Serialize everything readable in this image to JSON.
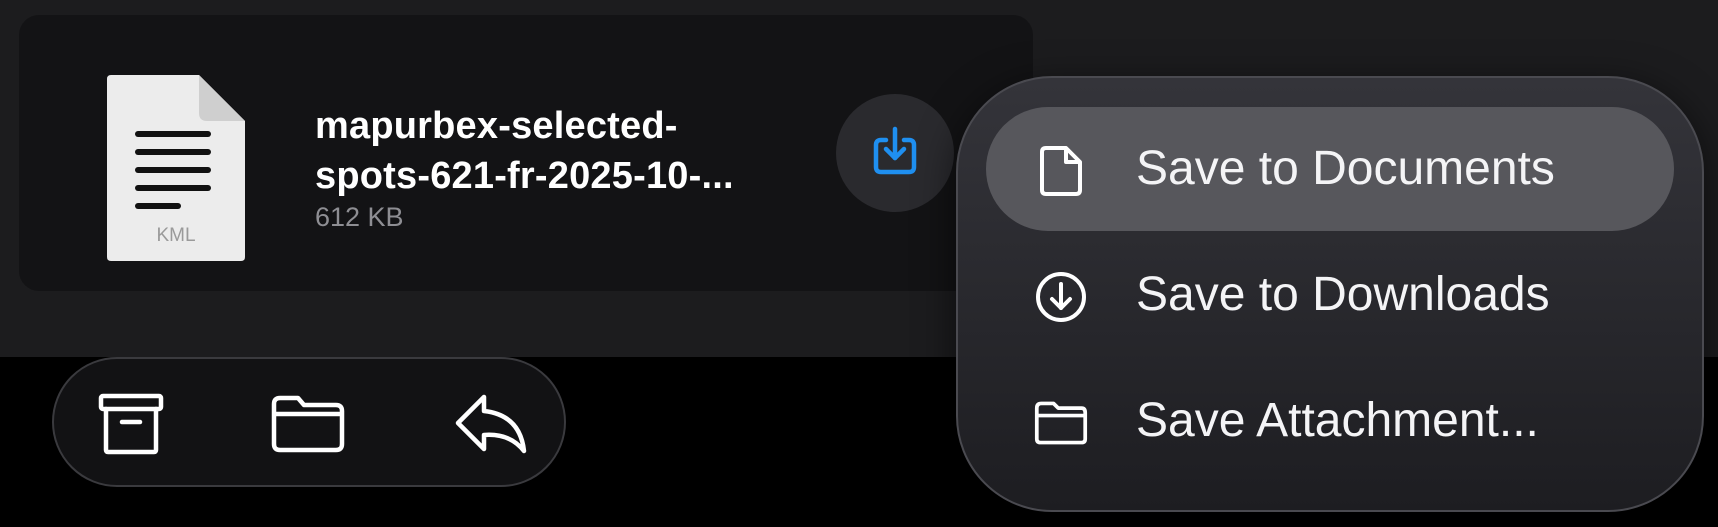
{
  "attachment": {
    "file_type": "KML",
    "name_line1": "mapurbex-selected-",
    "name_line2": "spots-621-fr-2025-10-...",
    "size": "612 KB",
    "download_icon": "download-tray-icon"
  },
  "toolbar": {
    "items": [
      {
        "icon": "archive-box-icon"
      },
      {
        "icon": "folder-icon"
      },
      {
        "icon": "reply-arrow-icon"
      }
    ]
  },
  "menu": {
    "items": [
      {
        "label": "Save to Documents",
        "icon": "document-icon",
        "highlighted": true
      },
      {
        "label": "Save to Downloads",
        "icon": "download-circle-icon",
        "highlighted": false
      },
      {
        "label": "Save Attachment...",
        "icon": "folder-icon",
        "highlighted": false
      }
    ]
  },
  "colors": {
    "accent": "#1f8ff0",
    "background": "#000000",
    "panel": "#1c1c1e",
    "card": "#131315",
    "menu_highlight": "#57575c",
    "secondary_text": "#8e8e93"
  }
}
